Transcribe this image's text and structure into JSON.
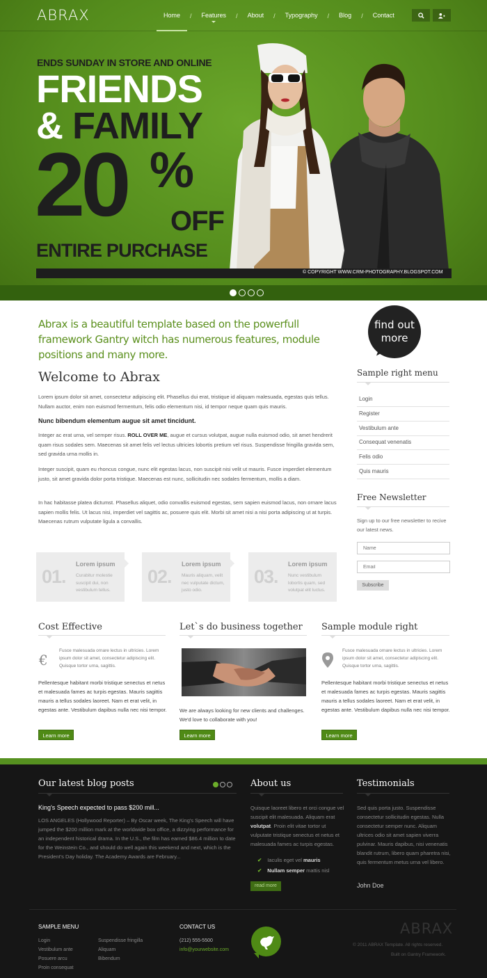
{
  "brand": {
    "logo": "ABRAX",
    "accent": "#5a9a1e",
    "dark": "#161616"
  },
  "nav": {
    "items": [
      "Home",
      "Features",
      "About",
      "Typography",
      "Blog",
      "Contact"
    ],
    "search_icon": "search-icon",
    "user_icon": "user-icon"
  },
  "banner": {
    "line1": "ENDS SUNDAY IN STORE AND ONLINE",
    "line2": "FRIENDS",
    "amp": "&",
    "line3": "FAMILY",
    "big": "20",
    "pct": "%",
    "off": "OFF",
    "line4": "ENTIRE PURCHASE",
    "copyright": "© COPYRIGHT WWW.CRM-PHOTOGRAPHY.BLOGSPOT.COM",
    "slides": 4,
    "active_slide": 1
  },
  "intro": {
    "text": "Abrax is a beautiful template based on the powerfull framework Gantry witch has numerous features, module positions and many more.",
    "button_line1": "find out",
    "button_line2": "more"
  },
  "welcome": {
    "title": "Welcome to Abrax",
    "p1": "Lorem ipsum dolor sit amet, consectetur adipiscing elit. Phasellus dui erat, tristique id aliquam malesuada, egestas quis tellus. Nullam auctor, enim non euismod fermentum, felis odio elementum nisi, id tempor neque quam quis mauris.",
    "bold": "Nunc bibendum elementum augue sit amet tincidunt.",
    "p2_a": "Integer ac erat urna, vel semper risus. ",
    "p2_b": "ROLL OVER ME",
    "p2_c": ", augue et cursus volutpat, augue nulla euismod odio, sit amet hendrerit quam risus sodales sem. Maecenas sit amet felis vel lectus ultricies lobortis pretium vel risus. Suspendisse fringilla gravida sem, sed gravida urna mollis in.",
    "p3": "Integer suscipit, quam eu rhoncus congue, nunc elit egestas lacus, non suscipit nisi velit ut mauris. Fusce imperdiet elementum justo, sit amet gravida dolor porta tristique. Maecenas est nunc, sollicitudin nec sodales fermentum, mollis a diam.",
    "p4": "In hac habitasse platea dictumst. Phasellus aliquet, odio convallis euismod egestas, sem sapien euismod lacus, non ornare lacus sapien mollis felis. Ut lacus nisi, imperdiet vel sagittis ac, posuere quis elit. Morbi sit amet nisi a nisi porta adipiscing ut at turpis. Maecenas rutrum vulputate ligula a convallis."
  },
  "features": [
    {
      "num": "01.",
      "title": "Lorem ipsum",
      "desc": "Curabitur molestie suscipit dui, non vestibulum tellus."
    },
    {
      "num": "02.",
      "title": "Lorem ipsum",
      "desc": "Mauris aliquam, velit nec vulputate dictum, justo odio."
    },
    {
      "num": "03.",
      "title": "Lorem ipsum",
      "desc": "Nunc vestibulum lobortis quam, sed volutpat elit luctus."
    }
  ],
  "sidebar": {
    "menu_title": "Sample right menu",
    "menu": [
      "Login",
      "Register",
      "Vestibulum ante",
      "Consequat venenatis",
      "Felis odio",
      "Quis mauris"
    ],
    "newsletter_title": "Free Newsletter",
    "newsletter_text": "Sign up to our free newsletter to recive our latest news.",
    "name_placeholder": "Name",
    "email_placeholder": "Email",
    "subscribe": "Subscribe"
  },
  "columns": {
    "c1": {
      "title": "Cost Effective",
      "small": "Fusce malesuada ornare lectus in ultricies. Lorem ipsum dolor sit amet, consectetur adipiscing elit. Quisque tortor urna, sagittis.",
      "body": "Pellentesque habitant morbi tristique senectus et netus et malesuada fames ac turpis egestas. Mauris sagittis mauris a tellus sodales laoreet. Nam et erat velit, in egestas ante. Vestibulum dapibus nulla nec nisi tempor.",
      "button": "Learn more"
    },
    "c2": {
      "title": "Let`s do business together",
      "body": "We are always looking for new clients and challenges. We'd love to collaborate with you!",
      "button": "Learn more"
    },
    "c3": {
      "title": "Sample module right",
      "small": "Fusce malesuada ornare lectus in ultricies. Lorem ipsum dolor sit amet, consectetur adipiscing elit. Quisque tortor urna, sagittis.",
      "body": "Pellentesque habitant morbi tristique senectus et netus et malesuada fames ac turpis egestas. Mauris sagittis mauris a tellus sodales laoreet. Nam et erat velit, in egestas ante. Vestibulum dapibus nulla nec nisi tempor.",
      "button": "Learn more"
    }
  },
  "footer": {
    "blog": {
      "title": "Our latest blog posts",
      "headline": "King's Speech expected to pass $200 mill...",
      "body": "LOS ANGELES (Hollywood Reporter) – By Oscar week, The King's Speech will have jumped the $200 million mark at the worldwide box office, a dizzying performance for an independent historical drama. In the U.S., the film has earned $86.4 million to date for the Weinstein Co., and should do well again this weekend and next, which is the President's Day holiday. The Academy Awards are February..."
    },
    "about": {
      "title": "About us",
      "body_a": "Quisque laoreet libero et orci congue vel suscipit elit malesuada. Aliquam erat ",
      "body_b": "volutpat",
      "body_c": ". Proin elit vitae tortor ut vulputate tristique senectus et netus et malesuada fames ac turpis egestas.",
      "check1_a": "Iaculis eget vel ",
      "check1_b": "mauris",
      "check2_a": "Nullam semper",
      "check2_b": " mattis nisl",
      "button": "read more"
    },
    "testimonials": {
      "title": "Testimonials",
      "body": "Sed quis porta justo. Suspendisse consectetur sollicitudin egestas. Nulla consectetur semper nunc. Aliquam ultrices odio sit amet sapien viverra pulvinar. Mauris dapibus, nisi venenatis blandit rutrum, libero quam pharetra nisi, quis fermentum metus urna vel libero.",
      "author": "John Doe"
    },
    "sample_menu_title": "SAMPLE MENU",
    "menu_left": [
      "Login",
      "Vestibulum ante",
      "Posuere arcu",
      "Proin consequat"
    ],
    "menu_right": [
      "Suspendisse fringilla",
      "Aliquam",
      "Bibendum"
    ],
    "contact_title": "CONTACT US",
    "phone": "(212) 555-5500",
    "email": "info@yourwebsite.com",
    "logo": "ABRAX",
    "copyright": "© 2011 ABRAX Template. All rights reserved.",
    "built": "Built on Gantry Framework."
  }
}
